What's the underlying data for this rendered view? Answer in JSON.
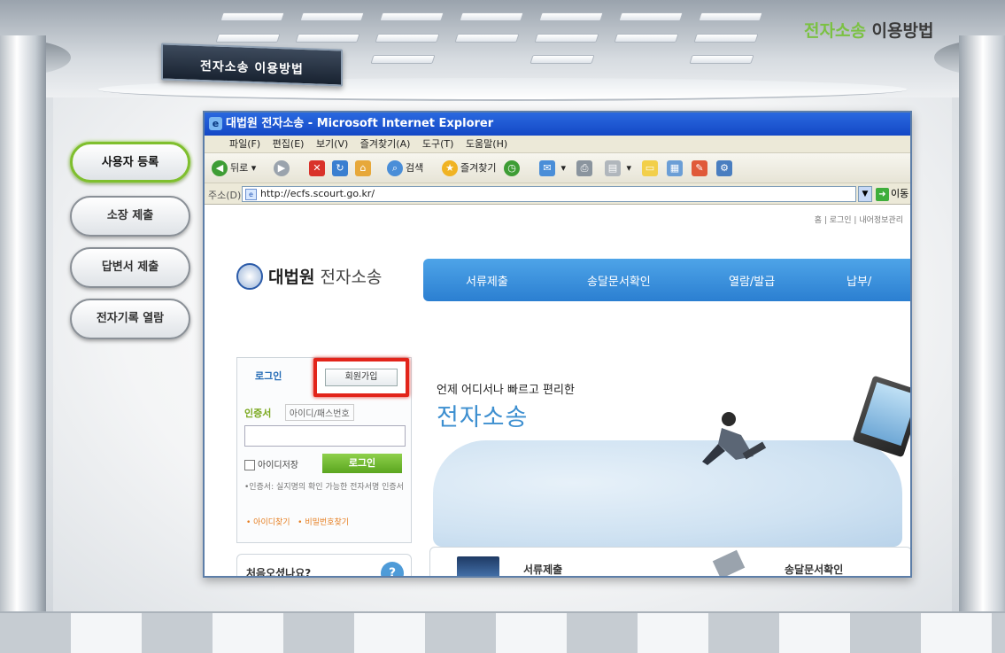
{
  "header": {
    "tab_title": "전자소송 이용방법",
    "corner_title_highlight": "전자소송",
    "corner_title_rest": " 이용방법"
  },
  "sidebar": {
    "items": [
      {
        "label": "사용자 등록",
        "active": true
      },
      {
        "label": "소장 제출",
        "active": false
      },
      {
        "label": "답변서 제출",
        "active": false
      },
      {
        "label": "전자기록 열람",
        "active": false
      }
    ]
  },
  "browser": {
    "title": "대법원 전자소송 - Microsoft Internet Explorer",
    "menu": [
      "파일(F)",
      "편집(E)",
      "보기(V)",
      "즐겨찾기(A)",
      "도구(T)",
      "도움말(H)"
    ],
    "toolbar": {
      "back": "뒤로",
      "search": "검색",
      "favorites": "즐겨찾기"
    },
    "address_label": "주소(D)",
    "address_value": "http://ecfs.scourt.go.kr/",
    "go_label": "이동"
  },
  "site": {
    "util_links": "홈 | 로그인 | 내어정보관리",
    "logo_bold": "대법원",
    "logo_thin": " 전자소송",
    "nav": [
      "서류제출",
      "송달문서확인",
      "열람/발급",
      "납부/"
    ],
    "login": {
      "tab_login": "로그인",
      "tab_join": "회원가입",
      "auth_cert": "인증서",
      "auth_id": "아이디/패스번호",
      "save_id": "아이디저장",
      "login_button": "로그인",
      "cert_note": "•인증서: 실지명의 확인 가능한 전자서명 인증서",
      "find_id": "• 아이디찾기",
      "find_pw": "• 비밀번호찾기"
    },
    "banner_sub": "언제 어디서나 빠르고 편리한",
    "banner_main": "전자소송",
    "help_title": "처음오셨나요?",
    "bottom_items": [
      "서류제출",
      "송달문서확인"
    ]
  },
  "colors": {
    "accent_green": "#7bc143",
    "ie_titlebar": "#2a69e0",
    "highlight_red": "#e2241a"
  }
}
